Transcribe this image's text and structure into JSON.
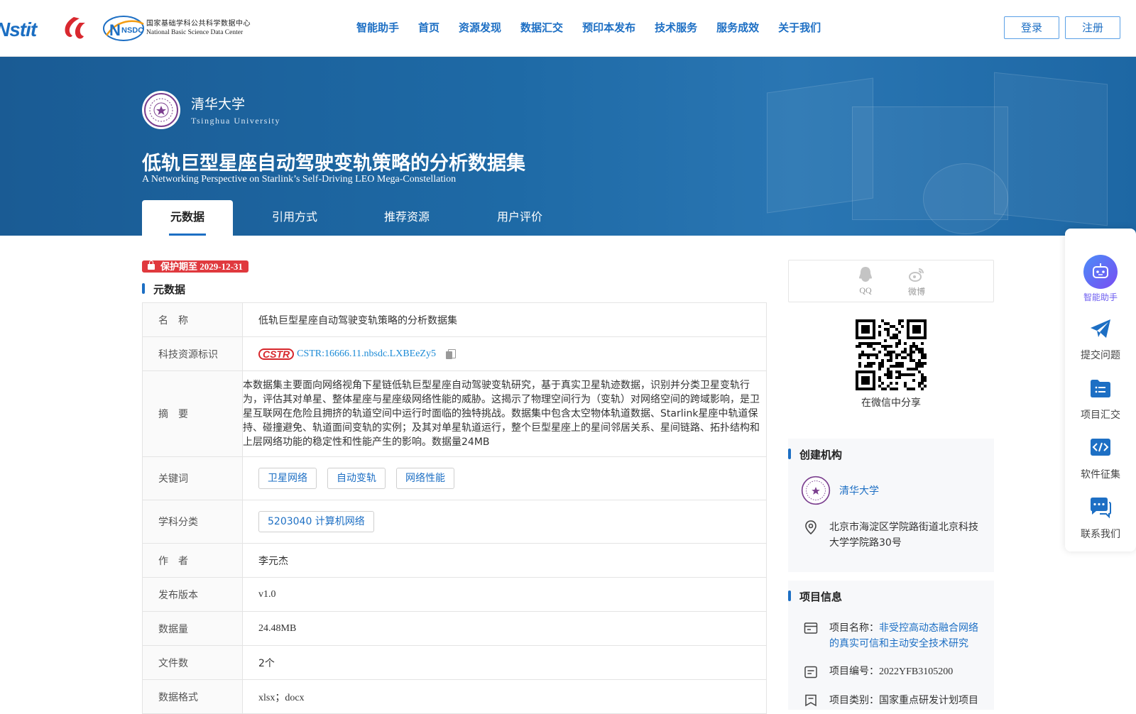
{
  "header": {
    "logo_cstr_text": "Nstit",
    "logo_nsdc_mark": "NSDC",
    "logo_nsdc_cn": "国家基础学科公共科学数据中心",
    "logo_nsdc_en": "National Basic Science Data Center",
    "nav": [
      "智能助手",
      "首页",
      "资源发现",
      "数据汇交",
      "预印本发布",
      "技术服务",
      "服务成效",
      "关于我们"
    ],
    "login_label": "登录",
    "register_label": "注册"
  },
  "banner": {
    "institution_cn": "清华大学",
    "institution_en": "Tsinghua University",
    "title": "低轨巨型星座自动驾驶变轨策略的分析数据集",
    "subtitle": "A Networking Perspective on Starlink’s Self-Driving LEO Mega-Constellation",
    "tabs": [
      "元数据",
      "引用方式",
      "推荐资源",
      "用户评价"
    ],
    "active_tab": 0
  },
  "protection_badge": "保护期至 2029-12-31",
  "metadata": {
    "section_title": "元数据",
    "rows": {
      "name_label": "名　称",
      "name_value": "低轨巨型星座自动驾驶变轨策略的分析数据集",
      "cstr_label": "科技资源标识",
      "cstr_logo": "CSTR",
      "cstr_value": "CSTR:16666.11.nbsdc.LXBEeZy5",
      "abstract_label": "摘　要",
      "abstract_value": "本数据集主要面向网络视角下星链低轨巨型星座自动驾驶变轨研究，基于真实卫星轨迹数据，识别并分类卫星变轨行为，评估其对单星、整体星座与星座级网络性能的威胁。这揭示了物理空间行为（变轨）对网络空间的跨域影响，是卫星互联网在危险且拥挤的轨道空间中运行时面临的独特挑战。数据集中包含太空物体轨道数据、Starlink星座中轨道保持、碰撞避免、轨道面间变轨的实例；及其对单星轨道运行，整个巨型星座上的星间邻居关系、星间链路、拓扑结构和上层网络功能的稳定性和性能产生的影响。数据量24MB",
      "keywords_label": "关键词",
      "keywords": [
        "卫星网络",
        "自动变轨",
        "网络性能"
      ],
      "subject_label": "学科分类",
      "subject_value": "5203040 计算机网络",
      "author_label": "作　者",
      "author_value": "李元杰",
      "version_label": "发布版本",
      "version_value": "v1.0",
      "size_label": "数据量",
      "size_value": "24.48MB",
      "files_label": "文件数",
      "files_value": "2个",
      "format_label": "数据格式",
      "format_value": "xlsx；docx"
    }
  },
  "share": {
    "qq_label": "QQ",
    "weibo_label": "微博",
    "wechat_caption": "在微信中分享"
  },
  "creator": {
    "section_title": "创建机构",
    "name": "清华大学",
    "address": "北京市海淀区学院路街道北京科技大学学院路30号"
  },
  "project": {
    "section_title": "项目信息",
    "name_prefix": "项目名称：",
    "name_value": "非受控高动态融合网络的真实可信和主动安全技术研究",
    "number": "项目编号：2022YFB3105200",
    "category": "项目类别：国家重点研发计划项目"
  },
  "sidepanel": [
    "智能助手",
    "提交问题",
    "项目汇交",
    "软件征集",
    "联系我们"
  ],
  "colors": {
    "primary": "#1d6fc4",
    "banner": "#1e6aa6",
    "badge": "#e0393e",
    "assistant": "#6b5bf0"
  }
}
